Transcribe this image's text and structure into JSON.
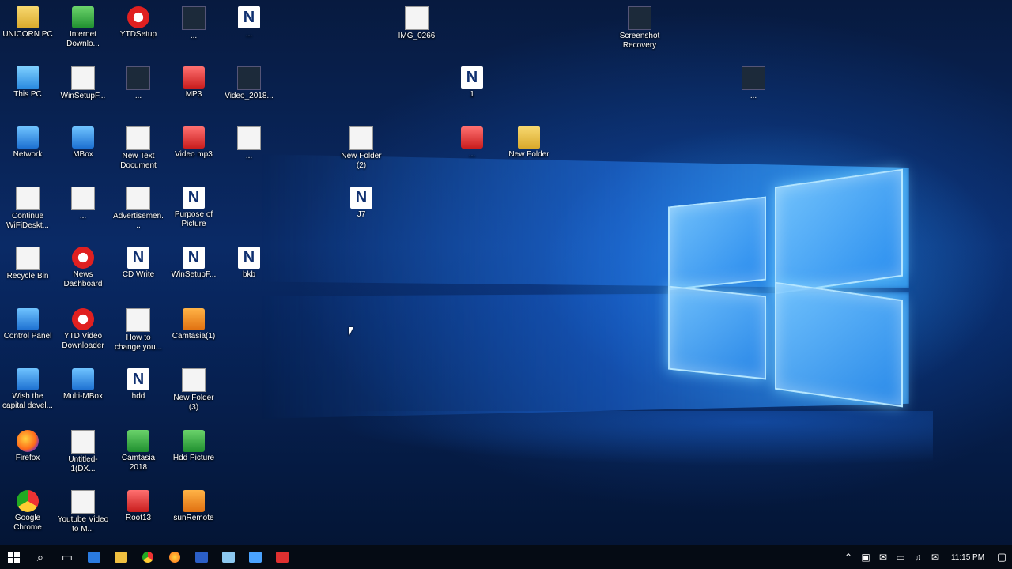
{
  "desktop": {
    "icons": [
      {
        "label": "UNICORN PC",
        "name": "desktop-icon-unicorn-pc",
        "glyph": "g-folder"
      },
      {
        "label": "Internet Downlo...",
        "name": "desktop-icon-internet-download",
        "glyph": "g-green"
      },
      {
        "label": "YTDSetup",
        "name": "desktop-icon-ytdsetup",
        "glyph": "g-circle-red"
      },
      {
        "label": "...",
        "name": "desktop-icon-file-1",
        "glyph": "g-dark"
      },
      {
        "label": "...",
        "name": "desktop-icon-file-2",
        "glyph": "g-app"
      },
      {
        "label": "IMG_0266",
        "name": "desktop-icon-img-0266",
        "glyph": "g-doc"
      },
      {
        "label": "Screenshot Recovery",
        "name": "desktop-icon-screenshot-recovery",
        "glyph": "g-dark"
      },
      {
        "label": "This PC",
        "name": "desktop-icon-this-pc",
        "glyph": "g-pc"
      },
      {
        "label": "WinSetupF...",
        "name": "desktop-icon-winsetup-1",
        "glyph": "g-doc"
      },
      {
        "label": "...",
        "name": "desktop-icon-file-3",
        "glyph": "g-dark"
      },
      {
        "label": "MP3",
        "name": "desktop-icon-mp3",
        "glyph": "g-red"
      },
      {
        "label": "Video_2018...",
        "name": "desktop-icon-video-2018",
        "glyph": "g-dark"
      },
      {
        "label": "1",
        "name": "desktop-icon-nitro-1",
        "glyph": "g-app"
      },
      {
        "label": "...",
        "name": "desktop-icon-file-4",
        "glyph": "g-dark"
      },
      {
        "label": "Network",
        "name": "desktop-icon-network",
        "glyph": "g-blue"
      },
      {
        "label": "MBox",
        "name": "desktop-icon-mbox",
        "glyph": "g-blue"
      },
      {
        "label": "New Text Document",
        "name": "desktop-icon-new-text-doc",
        "glyph": "g-doc"
      },
      {
        "label": "Video mp3",
        "name": "desktop-icon-video-mp3",
        "glyph": "g-red"
      },
      {
        "label": "...",
        "name": "desktop-icon-file-5",
        "glyph": "g-doc"
      },
      {
        "label": "New Folder (2)",
        "name": "desktop-icon-new-folder-2",
        "glyph": "g-doc"
      },
      {
        "label": "...",
        "name": "desktop-icon-winrar",
        "glyph": "g-red"
      },
      {
        "label": "New Folder",
        "name": "desktop-icon-new-folder",
        "glyph": "g-folder"
      },
      {
        "label": "Continue WiFiDeskt...",
        "name": "desktop-icon-continue-wifi",
        "glyph": "g-doc"
      },
      {
        "label": "...",
        "name": "desktop-icon-file-6",
        "glyph": "g-doc"
      },
      {
        "label": "Advertisemen...",
        "name": "desktop-icon-advertisement",
        "glyph": "g-doc"
      },
      {
        "label": "Purpose of Picture",
        "name": "desktop-icon-purpose-picture",
        "glyph": "g-app"
      },
      {
        "label": "J7",
        "name": "desktop-icon-j7",
        "glyph": "g-app"
      },
      {
        "label": "Recycle Bin",
        "name": "desktop-icon-recycle-bin",
        "glyph": "g-doc"
      },
      {
        "label": "News Dashboard",
        "name": "desktop-icon-news-dashboard",
        "glyph": "g-circle-red"
      },
      {
        "label": "CD Write",
        "name": "desktop-icon-cd-write",
        "glyph": "g-app"
      },
      {
        "label": "WinSetupF...",
        "name": "desktop-icon-winsetup-2",
        "glyph": "g-app"
      },
      {
        "label": "bkb",
        "name": "desktop-icon-bkb",
        "glyph": "g-app"
      },
      {
        "label": "Control Panel",
        "name": "desktop-icon-control-panel",
        "glyph": "g-blue"
      },
      {
        "label": "YTD Video Downloader",
        "name": "desktop-icon-ytd-video-downloader",
        "glyph": "g-circle-red"
      },
      {
        "label": "How to change you...",
        "name": "desktop-icon-how-to-change",
        "glyph": "g-doc"
      },
      {
        "label": "Camtasia(1)",
        "name": "desktop-icon-camtasia-1",
        "glyph": "g-orange"
      },
      {
        "label": "Wish the capital devel...",
        "name": "desktop-icon-wish-capital",
        "glyph": "g-blue"
      },
      {
        "label": "Multi-MBox",
        "name": "desktop-icon-multi-mbox",
        "glyph": "g-blue"
      },
      {
        "label": "hdd",
        "name": "desktop-icon-hdd",
        "glyph": "g-app"
      },
      {
        "label": "New Folder (3)",
        "name": "desktop-icon-new-folder-3",
        "glyph": "g-doc"
      },
      {
        "label": "Firefox",
        "name": "desktop-icon-firefox",
        "glyph": "g-firefox"
      },
      {
        "label": "Untitled-1(DX...",
        "name": "desktop-icon-untitled-1",
        "glyph": "g-doc"
      },
      {
        "label": "Camtasia 2018",
        "name": "desktop-icon-camtasia-2018",
        "glyph": "g-green"
      },
      {
        "label": "Hdd Picture",
        "name": "desktop-icon-hdd-picture",
        "glyph": "g-green"
      },
      {
        "label": "Google Chrome",
        "name": "desktop-icon-google-chrome",
        "glyph": "g-chrome"
      },
      {
        "label": "Youtube Video to M...",
        "name": "desktop-icon-youtube-video",
        "glyph": "g-doc"
      },
      {
        "label": "Root13",
        "name": "desktop-icon-root13",
        "glyph": "g-red"
      },
      {
        "label": "sunRemote",
        "name": "desktop-icon-sunremote",
        "glyph": "g-orange"
      }
    ]
  },
  "taskbar": {
    "start_icon": "windows-start-icon",
    "search_glyph": "⌕",
    "task_view_glyph": "▭",
    "clock": "11:15 PM",
    "tray_glyphs": [
      "⌃",
      "▣",
      "✉",
      "▭",
      "♫",
      "✉"
    ],
    "action_glyph": "▢"
  }
}
